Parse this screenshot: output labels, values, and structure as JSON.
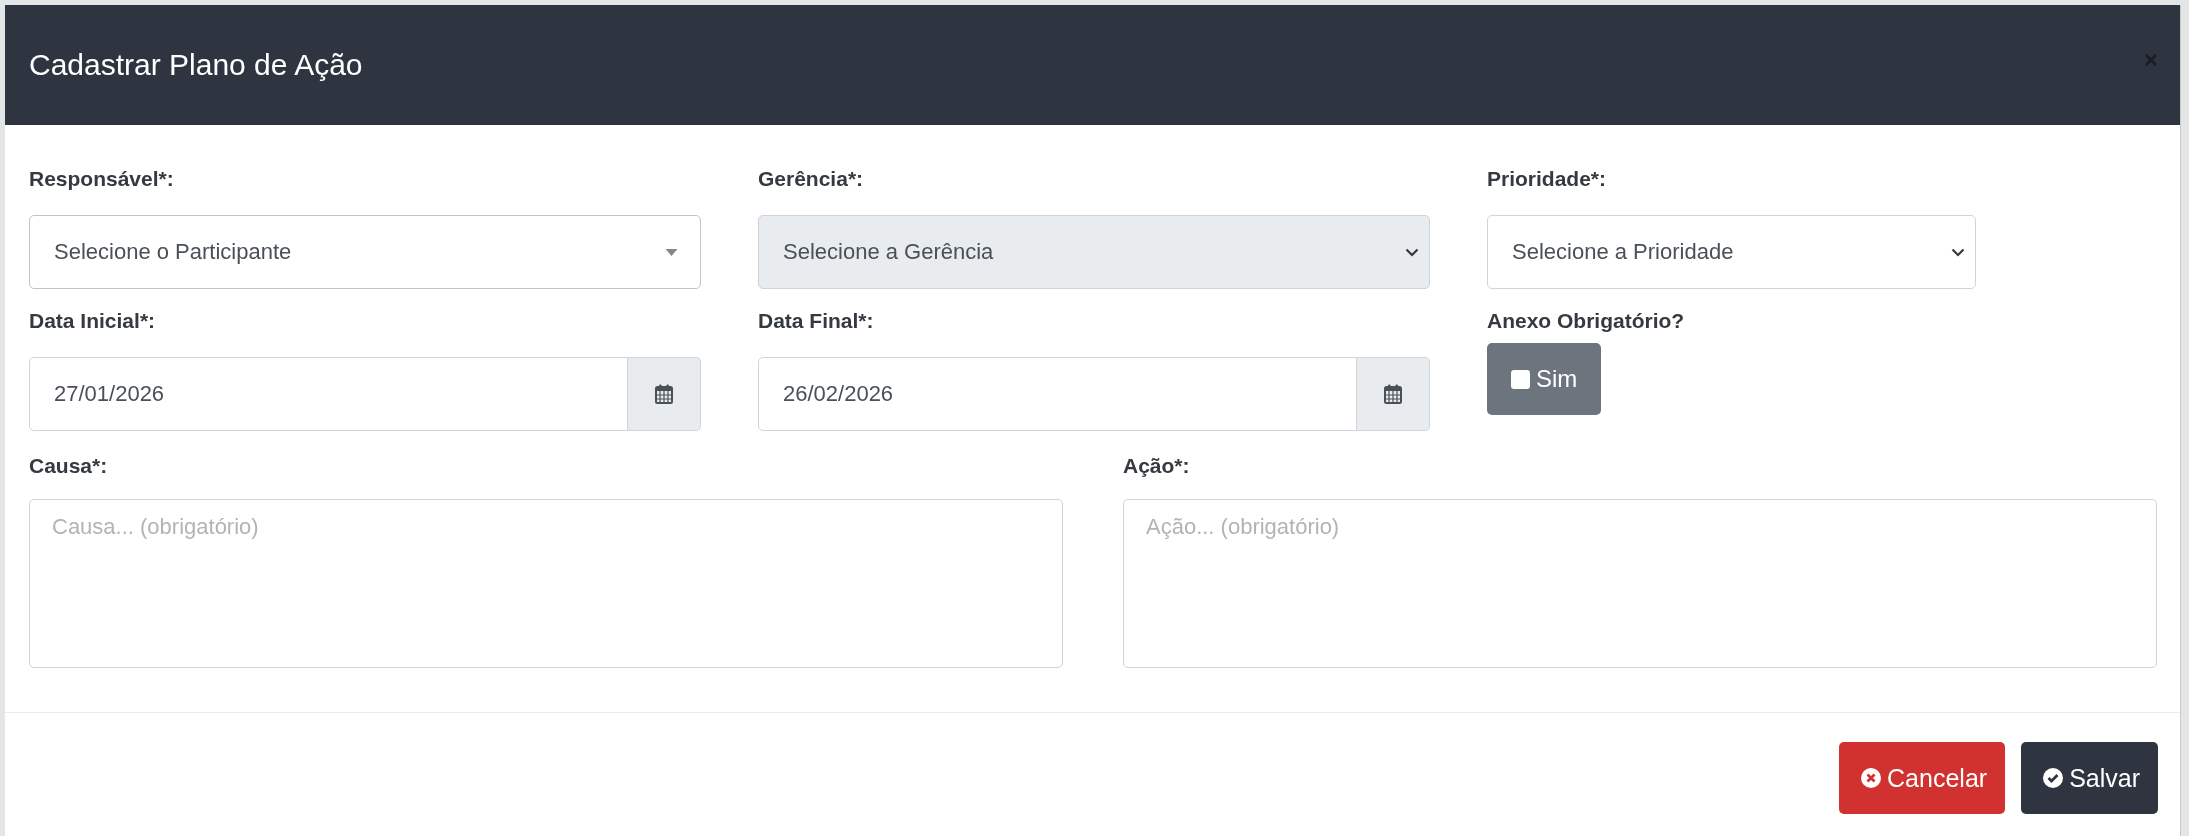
{
  "dialog": {
    "title": "Cadastrar Plano de Ação"
  },
  "rows": [
    [
      {
        "kind": "search-select",
        "label": "Responsável*:",
        "value": "Selecione o Participante",
        "disabled": false
      },
      {
        "kind": "select",
        "label": "Gerência*:",
        "value": "Selecione a Gerência",
        "disabled": true
      },
      {
        "kind": "select",
        "label": "Prioridade*:",
        "value": "Selecione a Prioridade",
        "disabled": false
      }
    ],
    [
      {
        "kind": "date",
        "label": "Data Inicial*:",
        "value": "27/01/2026"
      },
      {
        "kind": "date",
        "label": "Data Final*:",
        "value": "26/02/2026"
      },
      {
        "kind": "toggle",
        "label": "Anexo Obrigatório?",
        "text": "Sim",
        "checked": false
      }
    ],
    [
      {
        "kind": "textarea",
        "label": "Causa*:",
        "placeholder": "Causa... (obrigatório)"
      },
      {
        "kind": "textarea",
        "label": "Ação*:",
        "placeholder": "Ação... (obrigatório)"
      }
    ]
  ],
  "buttons": [
    {
      "kind": "cancel",
      "label": "Cancelar"
    },
    {
      "kind": "save",
      "label": "Salvar"
    }
  ]
}
